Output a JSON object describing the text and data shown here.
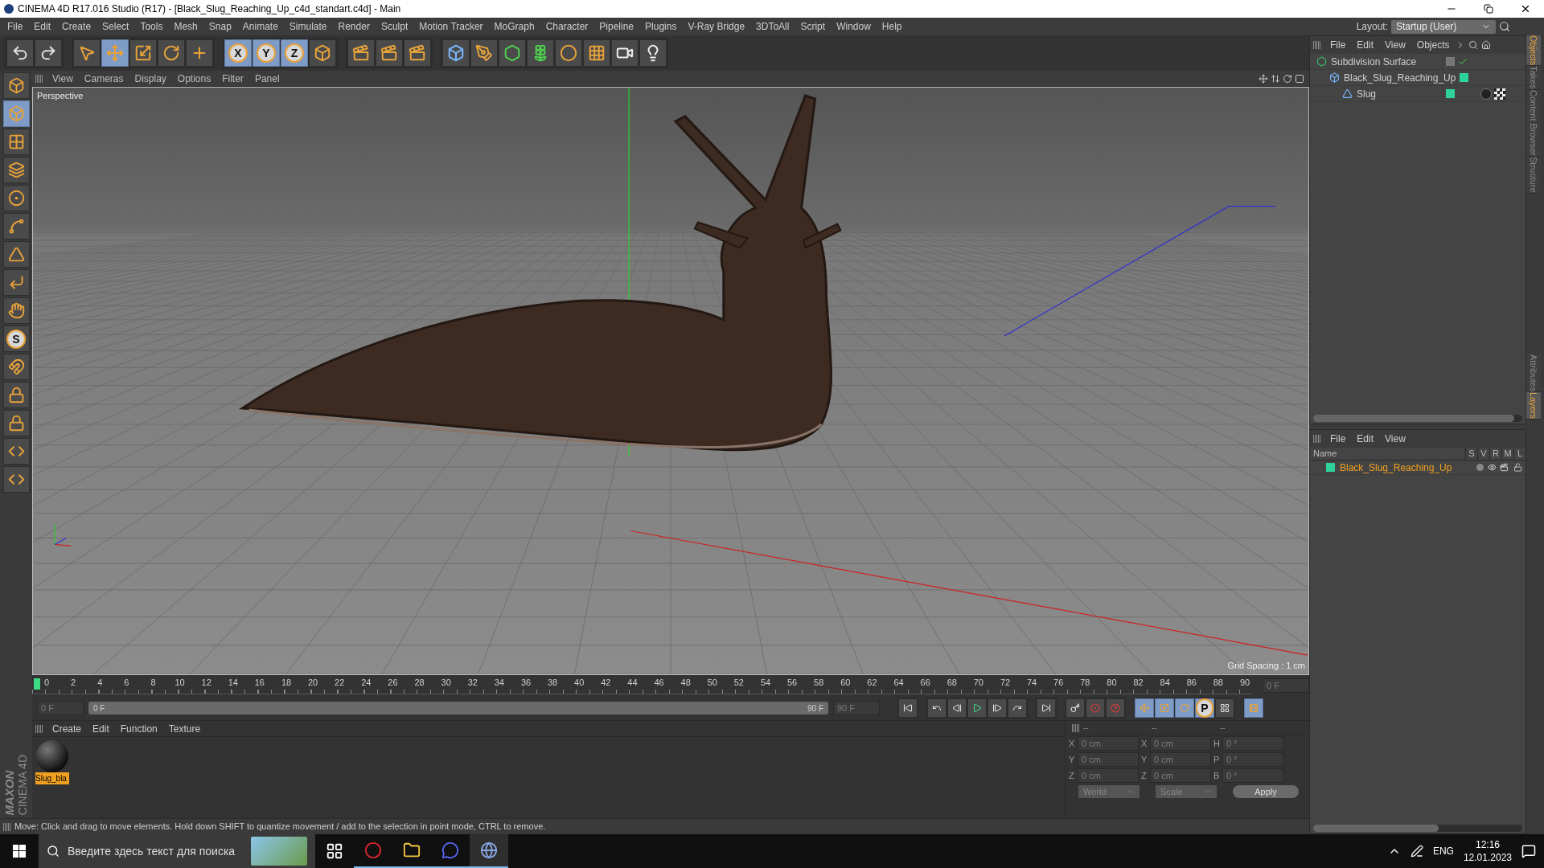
{
  "window": {
    "title": "CINEMA 4D R17.016 Studio (R17) - [Black_Slug_Reaching_Up_c4d_standart.c4d] - Main"
  },
  "menu": [
    "File",
    "Edit",
    "Create",
    "Select",
    "Tools",
    "Mesh",
    "Snap",
    "Animate",
    "Simulate",
    "Render",
    "Sculpt",
    "Motion Tracker",
    "MoGraph",
    "Character",
    "Pipeline",
    "Plugins",
    "V-Ray Bridge",
    "3DToAll",
    "Script",
    "Window",
    "Help"
  ],
  "layout": {
    "label": "Layout:",
    "value": "Startup (User)"
  },
  "toolbar": [
    {
      "kind": "undo",
      "selected": false
    },
    {
      "kind": "redo",
      "selected": false
    },
    {
      "kind": "select",
      "selected": false
    },
    {
      "kind": "move",
      "selected": true
    },
    {
      "kind": "scale",
      "selected": false
    },
    {
      "kind": "rotate",
      "selected": false
    },
    {
      "kind": "last",
      "selected": false
    },
    {
      "kind": "axis",
      "label": "X",
      "selected": true
    },
    {
      "kind": "axis",
      "label": "Y",
      "selected": true
    },
    {
      "kind": "axis",
      "label": "Z",
      "selected": true
    },
    {
      "kind": "coords",
      "selected": false
    },
    {
      "kind": "render",
      "selected": false
    },
    {
      "kind": "render",
      "selected": false
    },
    {
      "kind": "render",
      "selected": false
    },
    {
      "kind": "cube",
      "selected": false
    },
    {
      "kind": "pen",
      "selected": false
    },
    {
      "kind": "subdivision",
      "selected": false
    },
    {
      "kind": "cloner",
      "selected": false
    },
    {
      "kind": "deformer",
      "selected": false
    },
    {
      "kind": "floor",
      "selected": false
    },
    {
      "kind": "camera",
      "selected": false
    },
    {
      "kind": "light",
      "selected": false
    }
  ],
  "left_tools": [
    {
      "kind": "make",
      "selected": false
    },
    {
      "kind": "model",
      "selected": true
    },
    {
      "kind": "texture",
      "selected": false
    },
    {
      "kind": "workplane",
      "selected": false
    },
    {
      "kind": "points",
      "selected": false
    },
    {
      "kind": "edges",
      "selected": false
    },
    {
      "kind": "polygons",
      "selected": false
    },
    {
      "kind": "axis",
      "selected": false
    },
    {
      "kind": "tweak",
      "selected": false
    },
    {
      "kind": "snap",
      "label": "S",
      "selected": false
    },
    {
      "kind": "magnet",
      "selected": false
    },
    {
      "kind": "lock",
      "selected": false
    },
    {
      "kind": "lock",
      "selected": false
    },
    {
      "kind": "python",
      "selected": false
    },
    {
      "kind": "python",
      "selected": false
    }
  ],
  "logo": {
    "brand": "MAXON",
    "product": "CINEMA 4D"
  },
  "viewport": {
    "menu": [
      "View",
      "Cameras",
      "Display",
      "Options",
      "Filter",
      "Panel"
    ],
    "camera": "Perspective",
    "grid_spacing": "Grid Spacing : 1 cm"
  },
  "timeline": {
    "ticks": [
      "0",
      "2",
      "4",
      "6",
      "8",
      "10",
      "12",
      "14",
      "16",
      "18",
      "20",
      "22",
      "24",
      "26",
      "28",
      "30",
      "32",
      "34",
      "36",
      "38",
      "40",
      "42",
      "44",
      "46",
      "48",
      "50",
      "52",
      "54",
      "56",
      "58",
      "60",
      "62",
      "64",
      "66",
      "68",
      "70",
      "72",
      "74",
      "76",
      "78",
      "80",
      "82",
      "84",
      "86",
      "88",
      "90"
    ],
    "current": "0 F",
    "start": "0 F",
    "range_start": "0 F",
    "range_end": "90 F",
    "end": "90 F"
  },
  "transport": [
    {
      "kind": "start",
      "selected": false
    },
    {
      "kind": "prev_key",
      "selected": false
    },
    {
      "kind": "prev_frame",
      "selected": false
    },
    {
      "kind": "play",
      "selected": false
    },
    {
      "kind": "next_frame",
      "selected": false
    },
    {
      "kind": "next_key",
      "selected": false
    },
    {
      "kind": "end",
      "selected": false
    },
    {
      "kind": "keys",
      "selected": false
    },
    {
      "kind": "record",
      "selected": false
    },
    {
      "kind": "auto",
      "selected": false
    },
    {
      "kind": "position",
      "selected": true
    },
    {
      "kind": "scale",
      "selected": true
    },
    {
      "kind": "rotation",
      "selected": true
    },
    {
      "kind": "param",
      "label": "P",
      "selected": true
    },
    {
      "kind": "pla",
      "selected": false
    },
    {
      "kind": "timeline",
      "selected": true
    }
  ],
  "materials": {
    "menu": [
      "Create",
      "Edit",
      "Function",
      "Texture"
    ],
    "items": [
      {
        "name": "Slug_bla",
        "selected": true
      }
    ]
  },
  "coordinates": {
    "headers": [
      "--",
      "--",
      "--"
    ],
    "rows": [
      {
        "axis": "X",
        "position": "0 cm",
        "size_axis": "X",
        "size": "0 cm",
        "rot_axis": "H",
        "rotation": "0 °"
      },
      {
        "axis": "Y",
        "position": "0 cm",
        "size_axis": "Y",
        "size": "0 cm",
        "rot_axis": "P",
        "rotation": "0 °"
      },
      {
        "axis": "Z",
        "position": "0 cm",
        "size_axis": "Z",
        "size": "0 cm",
        "rot_axis": "B",
        "rotation": "0 °"
      }
    ],
    "space": "World",
    "mode": "Scale",
    "apply": "Apply"
  },
  "status_bar": "Move: Click and drag to move elements. Hold down SHIFT to quantize movement / add to the selection in point mode, CTRL to remove.",
  "objects": {
    "menu": [
      "File",
      "Edit",
      "View",
      "Objects"
    ],
    "tree": [
      {
        "name": "Subdivision Surface",
        "kind": "generator",
        "enabled": true,
        "children": [
          {
            "name": "Black_Slug_Reaching_Up",
            "kind": "null",
            "color": "#2fd39a",
            "enabled": false,
            "children": [
              {
                "name": "Slug",
                "kind": "polygon",
                "color": "#2fd39a",
                "enabled": false
              }
            ]
          }
        ]
      }
    ]
  },
  "layers": {
    "menu": [
      "File",
      "Edit",
      "View"
    ],
    "columns": [
      "Name",
      "S",
      "V",
      "R",
      "M",
      "L"
    ],
    "rows": [
      {
        "name": "Black_Slug_Reaching_Up",
        "color": "#2fd39a"
      }
    ]
  },
  "side_tabs_top": [
    {
      "label": "Objects",
      "selected": true
    },
    {
      "label": "Takes",
      "selected": false
    },
    {
      "label": "Content Browser",
      "selected": false
    },
    {
      "label": "Structure",
      "selected": false
    }
  ],
  "side_tabs_bottom": [
    {
      "label": "Attributes",
      "selected": false
    },
    {
      "label": "Layers",
      "selected": true
    }
  ],
  "taskbar": {
    "search_placeholder": "Введите здесь текст для поиска",
    "apps": [
      {
        "kind": "taskview",
        "active": false
      },
      {
        "kind": "opera",
        "active": true
      },
      {
        "kind": "explorer",
        "active": true
      },
      {
        "kind": "discord",
        "active": true
      },
      {
        "kind": "cinema",
        "active": true
      }
    ],
    "language": "ENG",
    "time": "12:16",
    "date": "12.01.2023"
  }
}
